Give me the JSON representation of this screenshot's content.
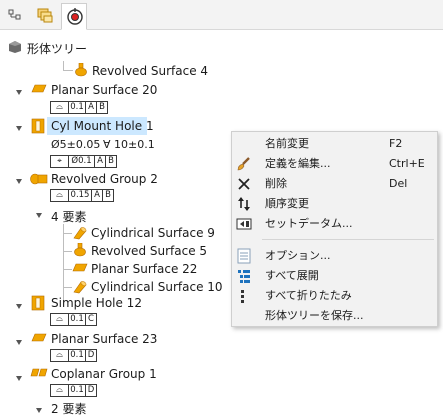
{
  "tabs": [
    {
      "icon": "model-tree-tab-icon"
    },
    {
      "icon": "layer-tree-tab-icon"
    },
    {
      "icon": "detail-tree-tab-icon"
    }
  ],
  "tree": {
    "root": "形体ツリー",
    "revolved_surface_4": "Revolved Surface 4",
    "planar_surface_20": "Planar Surface 20",
    "cyl_mount_hole_1": "Cyl Mount Hole 1",
    "hole_dim_diameter": "Ø5±0.05",
    "hole_dim_depth": "∀ 10±0.1",
    "revolved_group_2": "Revolved Group 2",
    "elements_4": "4 要素",
    "cylindrical_surface_9": "Cylindrical Surface 9",
    "revolved_surface_5": "Revolved Surface 5",
    "planar_surface_22": "Planar Surface 22",
    "cylindrical_surface_10": "Cylindrical Surface 10",
    "simple_hole_12": "Simple Hole 12",
    "planar_surface_23": "Planar Surface 23",
    "coplanar_group_1": "Coplanar Group 1",
    "elements_2": "2 要素",
    "fcf": {
      "ps20": [
        "⌓",
        "0.1",
        "A",
        "B"
      ],
      "hole1": [
        "⌖",
        "Ø0.1",
        "A",
        "B"
      ],
      "rg2": [
        "⌓",
        "0.15",
        "A",
        "B"
      ],
      "sh12": [
        "⌓",
        "0.1",
        "C"
      ],
      "ps23": [
        "⌓",
        "0.1",
        "D"
      ],
      "cg1": [
        "⌓",
        "0.1",
        "D"
      ]
    }
  },
  "context_menu": {
    "items": [
      {
        "label": "名前変更",
        "shortcut": "F2",
        "icon": "rename-icon"
      },
      {
        "label": "定義を編集...",
        "shortcut": "Ctrl+E",
        "icon": "edit-definition-brush-icon"
      },
      {
        "label": "削除",
        "shortcut": "Del",
        "icon": "delete-x-icon"
      },
      {
        "label": "順序変更",
        "shortcut": "",
        "icon": "reorder-arrows-icon"
      },
      {
        "label": "セットデータム...",
        "shortcut": "",
        "icon": "set-datum-icon"
      },
      {
        "label": "オプション...",
        "shortcut": "",
        "icon": "options-icon"
      },
      {
        "label": "すべて展開",
        "shortcut": "",
        "icon": "expand-all-icon"
      },
      {
        "label": "すべて折りたたみ",
        "shortcut": "",
        "icon": "collapse-all-icon"
      },
      {
        "label": "形体ツリーを保存...",
        "shortcut": "",
        "icon": ""
      }
    ]
  },
  "colors": {
    "selection": "#cce8ff",
    "planar_icon": "#f0a500",
    "revolved_icon": "#f0a500",
    "hole_icon": "#f0a500",
    "menu_bg": "#f2f2f2"
  }
}
